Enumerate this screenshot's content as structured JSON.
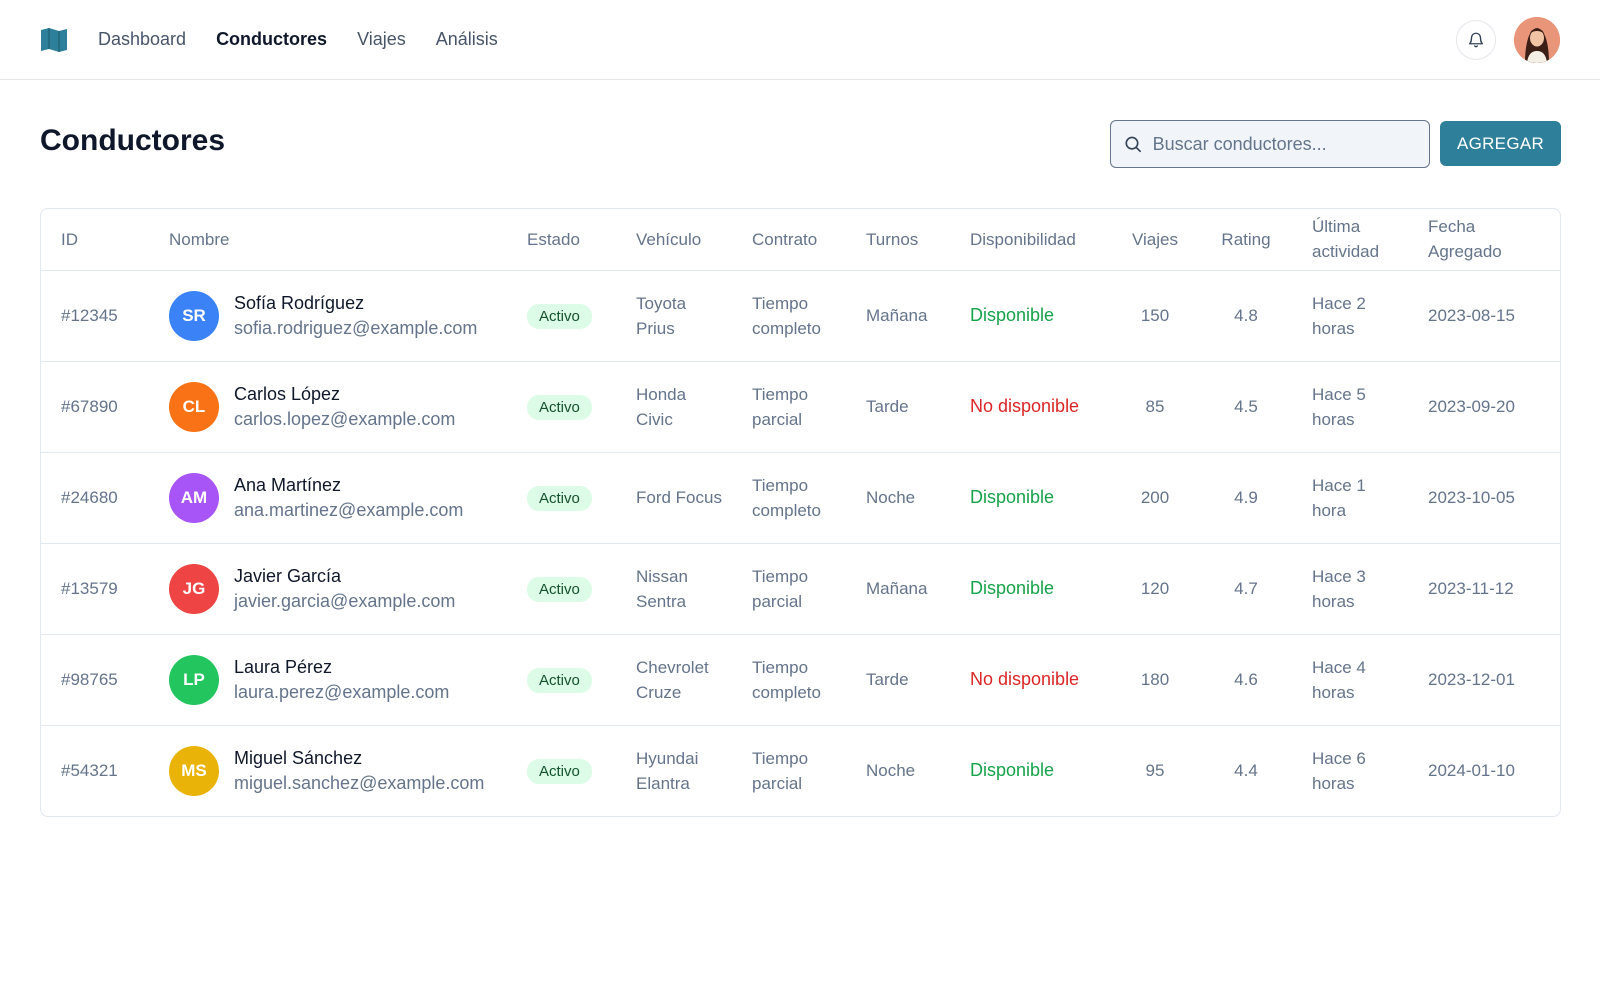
{
  "nav": {
    "items": [
      {
        "label": "Dashboard",
        "active": false
      },
      {
        "label": "Conductores",
        "active": true
      },
      {
        "label": "Viajes",
        "active": false
      },
      {
        "label": "Análisis",
        "active": false
      }
    ],
    "icons": {
      "logo": "folded-map-icon",
      "notifications": "bell-icon",
      "user": "user-avatar"
    }
  },
  "page": {
    "title": "Conductores",
    "search_placeholder": "Buscar conductores...",
    "add_label": "AGREGAR"
  },
  "colors": {
    "accent": "#2e7f99",
    "available": "#16a34a",
    "unavailable": "#dc2626",
    "badge_bg": "#dcfce7"
  },
  "table": {
    "headers": {
      "id": "ID",
      "nombre": "Nombre",
      "estado": "Estado",
      "vehiculo": "Vehículo",
      "contrato": "Contrato",
      "turnos": "Turnos",
      "disponibilidad": "Disponibilidad",
      "viajes": "Viajes",
      "rating": "Rating",
      "ultima": "Última actividad",
      "fecha": "Fecha Agregado"
    },
    "rows": [
      {
        "id": "#12345",
        "initials": "SR",
        "avatar_color": "#3b82f6",
        "name": "Sofía Rodríguez",
        "email": "sofia.rodriguez@example.com",
        "estado": "Activo",
        "vehiculo": "Toyota Prius",
        "contrato": "Tiempo completo",
        "turno": "Mañana",
        "disponibilidad": "Disponible",
        "available": true,
        "viajes": "150",
        "rating": "4.8",
        "ultima": "Hace 2 horas",
        "fecha": "2023-08-15"
      },
      {
        "id": "#67890",
        "initials": "CL",
        "avatar_color": "#f97316",
        "name": "Carlos López",
        "email": "carlos.lopez@example.com",
        "estado": "Activo",
        "vehiculo": "Honda Civic",
        "contrato": "Tiempo parcial",
        "turno": "Tarde",
        "disponibilidad": "No disponible",
        "available": false,
        "viajes": "85",
        "rating": "4.5",
        "ultima": "Hace 5 horas",
        "fecha": "2023-09-20"
      },
      {
        "id": "#24680",
        "initials": "AM",
        "avatar_color": "#a855f7",
        "name": "Ana Martínez",
        "email": "ana.martinez@example.com",
        "estado": "Activo",
        "vehiculo": "Ford Focus",
        "contrato": "Tiempo completo",
        "turno": "Noche",
        "disponibilidad": "Disponible",
        "available": true,
        "viajes": "200",
        "rating": "4.9",
        "ultima": "Hace 1 hora",
        "fecha": "2023-10-05"
      },
      {
        "id": "#13579",
        "initials": "JG",
        "avatar_color": "#ef4444",
        "name": "Javier García",
        "email": "javier.garcia@example.com",
        "estado": "Activo",
        "vehiculo": "Nissan Sentra",
        "contrato": "Tiempo parcial",
        "turno": "Mañana",
        "disponibilidad": "Disponible",
        "available": true,
        "viajes": "120",
        "rating": "4.7",
        "ultima": "Hace 3 horas",
        "fecha": "2023-11-12"
      },
      {
        "id": "#98765",
        "initials": "LP",
        "avatar_color": "#22c55e",
        "name": "Laura Pérez",
        "email": "laura.perez@example.com",
        "estado": "Activo",
        "vehiculo": "Chevrolet Cruze",
        "contrato": "Tiempo completo",
        "turno": "Tarde",
        "disponibilidad": "No disponible",
        "available": false,
        "viajes": "180",
        "rating": "4.6",
        "ultima": "Hace 4 horas",
        "fecha": "2023-12-01"
      },
      {
        "id": "#54321",
        "initials": "MS",
        "avatar_color": "#eab308",
        "name": "Miguel Sánchez",
        "email": "miguel.sanchez@example.com",
        "estado": "Activo",
        "vehiculo": "Hyundai Elantra",
        "contrato": "Tiempo parcial",
        "turno": "Noche",
        "disponibilidad": "Disponible",
        "available": true,
        "viajes": "95",
        "rating": "4.4",
        "ultima": "Hace 6 horas",
        "fecha": "2024-01-10"
      }
    ]
  }
}
